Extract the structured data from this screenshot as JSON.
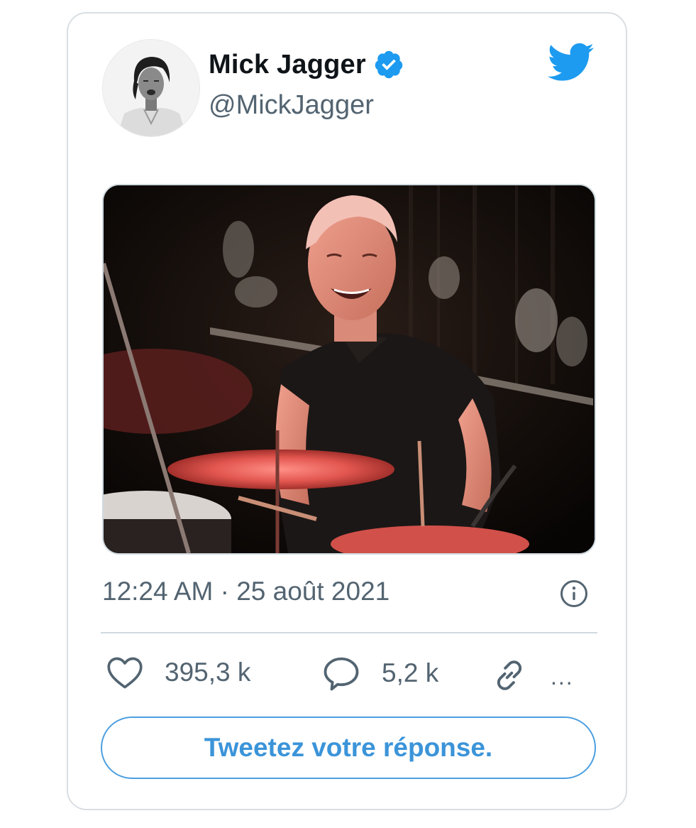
{
  "tweet": {
    "author": {
      "display_name": "Mick Jagger",
      "handle": "@MickJagger",
      "verified": true,
      "avatar": "avatar-photo"
    },
    "brand_icon": "twitter-bird-icon",
    "media": {
      "description": "tweet-photo"
    },
    "timestamp": "12:24 AM · 25 août 2021",
    "info_icon": "info-icon",
    "actions": {
      "likes": {
        "icon": "heart-icon",
        "count": "395,3 k"
      },
      "replies": {
        "icon": "reply-bubble-icon",
        "count": "5,2 k"
      },
      "copy_link": {
        "icon": "link-icon"
      },
      "more": {
        "label": "..."
      }
    },
    "reply_button": {
      "label": "Tweetez votre réponse."
    }
  },
  "colors": {
    "brand_blue": "#1d9bf0",
    "button_blue": "#3b94d9",
    "text_primary": "#0f1419",
    "text_secondary": "#536471",
    "border": "#cfd9de"
  }
}
